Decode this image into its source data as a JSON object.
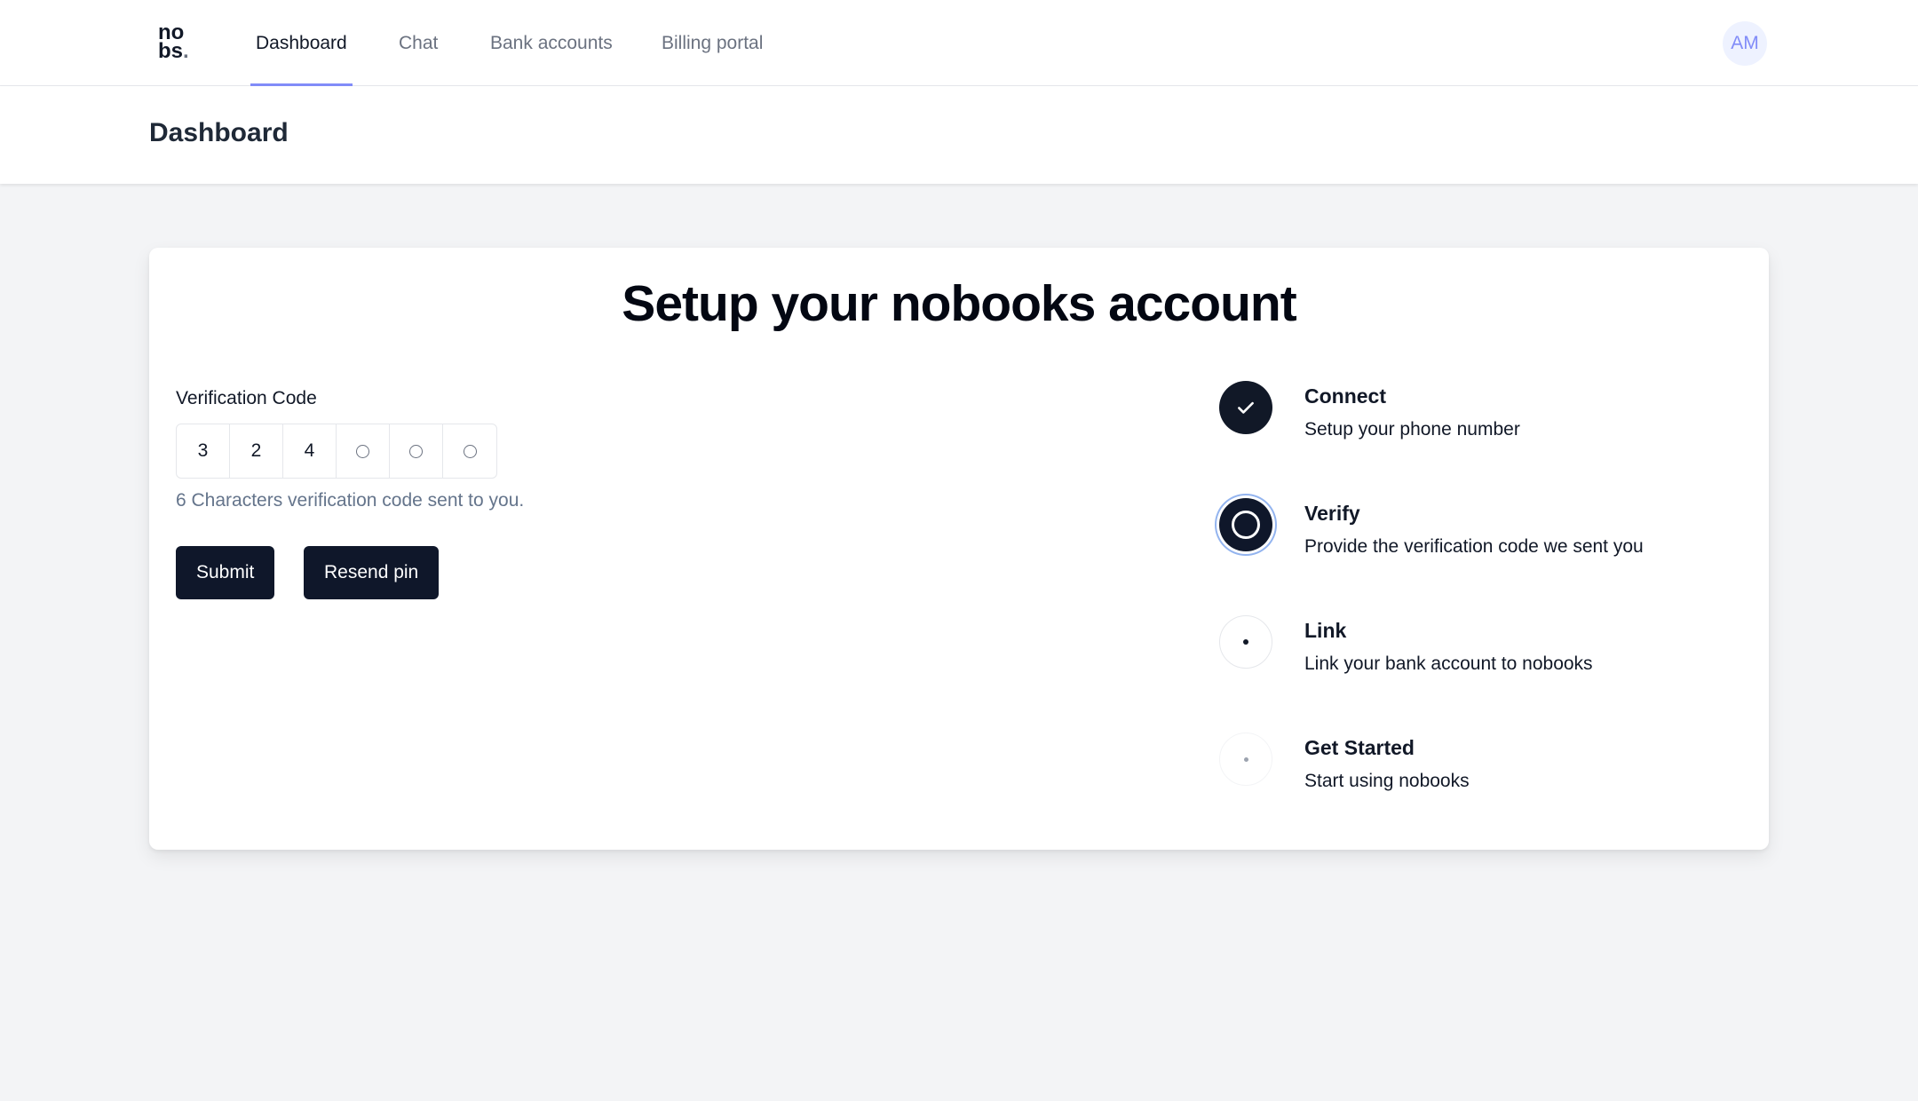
{
  "nav": {
    "logo_line1": "no",
    "logo_line2": "bs",
    "logo_dot": ".",
    "links": [
      {
        "label": "Dashboard",
        "active": true
      },
      {
        "label": "Chat",
        "active": false
      },
      {
        "label": "Bank accounts",
        "active": false
      },
      {
        "label": "Billing portal",
        "active": false
      }
    ],
    "avatar_initials": "AM"
  },
  "header": {
    "title": "Dashboard"
  },
  "setup": {
    "title": "Setup your nobooks account",
    "verification_label": "Verification Code",
    "code_digits": [
      "3",
      "2",
      "4",
      "",
      "",
      ""
    ],
    "hint": "6 Characters verification code sent to you.",
    "submit_label": "Submit",
    "resend_label": "Resend pin"
  },
  "steps": [
    {
      "title": "Connect",
      "description": "Setup your phone number",
      "status": "complete",
      "icon": "check-icon"
    },
    {
      "title": "Verify",
      "description": "Provide the verification code we sent you",
      "status": "current",
      "icon": "ring-icon"
    },
    {
      "title": "Link",
      "description": "Link your bank account to nobooks",
      "status": "upcoming",
      "icon": "dot-icon"
    },
    {
      "title": "Get Started",
      "description": "Start using nobooks",
      "status": "upcoming",
      "icon": "dot-icon"
    }
  ],
  "colors": {
    "primary": "#0f172a",
    "active_underline": "#818cf8",
    "background": "#f3f4f6",
    "hint_text": "#64748b"
  }
}
